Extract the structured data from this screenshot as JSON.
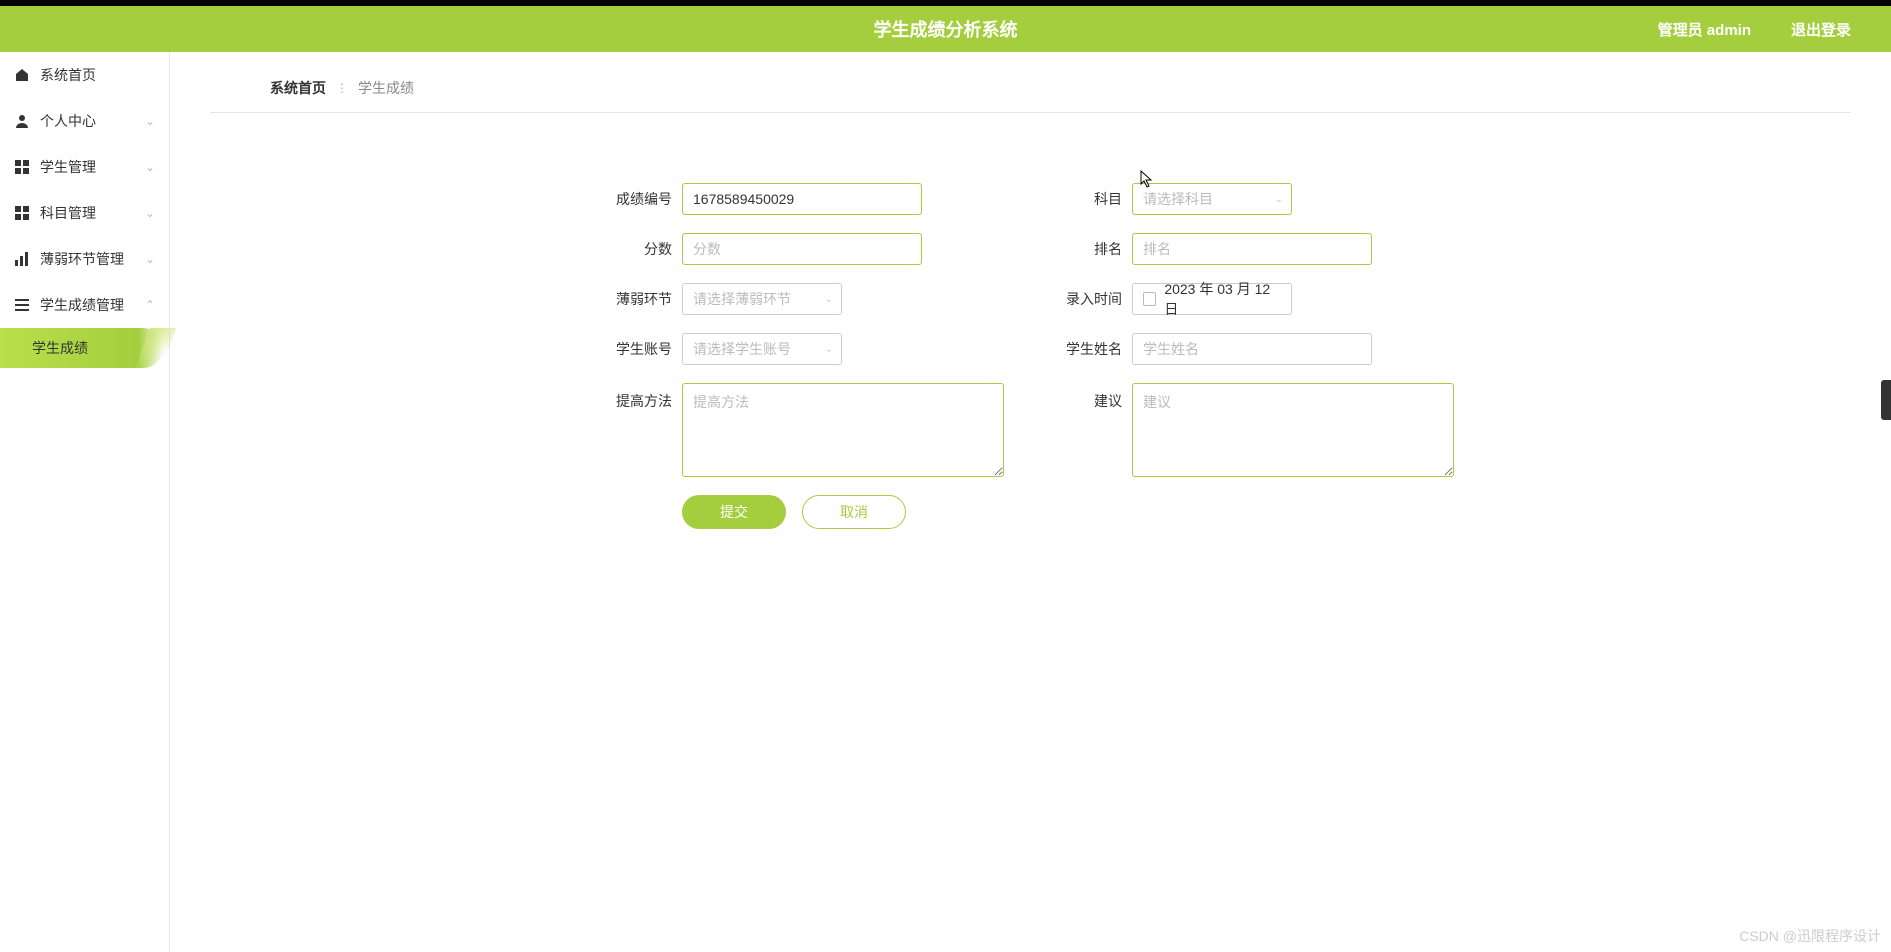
{
  "header": {
    "title": "学生成绩分析系统",
    "admin_label": "管理员 admin",
    "logout_label": "退出登录"
  },
  "sidebar": {
    "items": [
      {
        "label": "系统首页",
        "icon": "home"
      },
      {
        "label": "个人中心",
        "icon": "user",
        "expandable": true
      },
      {
        "label": "学生管理",
        "icon": "grid",
        "expandable": true
      },
      {
        "label": "科目管理",
        "icon": "grid",
        "expandable": true
      },
      {
        "label": "薄弱环节管理",
        "icon": "bars",
        "expandable": true
      },
      {
        "label": "学生成绩管理",
        "icon": "list",
        "expandable": true,
        "expanded": true
      }
    ],
    "submenu_active": "学生成绩"
  },
  "breadcrumb": {
    "home": "系统首页",
    "current": "学生成绩"
  },
  "form": {
    "score_id": {
      "label": "成绩编号",
      "value": "1678589450029"
    },
    "subject": {
      "label": "科目",
      "placeholder": "请选择科目"
    },
    "score": {
      "label": "分数",
      "placeholder": "分数"
    },
    "rank": {
      "label": "排名",
      "placeholder": "排名"
    },
    "weak": {
      "label": "薄弱环节",
      "placeholder": "请选择薄弱环节"
    },
    "entry_time": {
      "label": "录入时间",
      "value": "2023 年 03 月 12 日"
    },
    "student_account": {
      "label": "学生账号",
      "placeholder": "请选择学生账号"
    },
    "student_name": {
      "label": "学生姓名",
      "placeholder": "学生姓名"
    },
    "improve": {
      "label": "提高方法",
      "placeholder": "提高方法"
    },
    "suggestion": {
      "label": "建议",
      "placeholder": "建议"
    }
  },
  "buttons": {
    "submit": "提交",
    "cancel": "取消"
  },
  "watermark": "CSDN @迅限程序设计"
}
